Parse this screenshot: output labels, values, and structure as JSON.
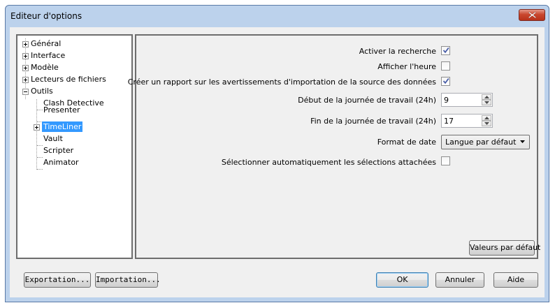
{
  "window": {
    "title": "Editeur d'options",
    "close_icon": "close-x-icon",
    "close_color": "#c9472e"
  },
  "tree": {
    "items": [
      {
        "label": "Général",
        "expander": "plus"
      },
      {
        "label": "Interface",
        "expander": "plus"
      },
      {
        "label": "Modèle",
        "expander": "plus"
      },
      {
        "label": "Lecteurs de fichiers",
        "expander": "plus"
      },
      {
        "label": "Outils",
        "expander": "minus"
      },
      {
        "label": "Clash Detective"
      },
      {
        "label": "Presenter"
      },
      {
        "label": "TimeLiner",
        "expander": "plus",
        "selected": true
      },
      {
        "label": "Vault"
      },
      {
        "label": "Scripter"
      },
      {
        "label": "Animator"
      }
    ],
    "selection_color": "#3399ff"
  },
  "options": {
    "activer_recherche": {
      "label": "Activer la recherche",
      "checked": true
    },
    "afficher_heure": {
      "label": "Afficher l'heure",
      "checked": false
    },
    "creer_rapport": {
      "label": "Créer un rapport sur les avertissements d'importation de la source des données",
      "checked": true
    },
    "debut_journee": {
      "label": "Début de la journée de travail (24h)",
      "value": "9"
    },
    "fin_journee": {
      "label": "Fin de la journée de travail (24h)",
      "value": "17"
    },
    "format_date": {
      "label": "Format de date",
      "value": "Langue par défaut"
    },
    "selection_auto": {
      "label": "Sélectionner automatiquement les sélections attachées",
      "checked": false
    }
  },
  "buttons": {
    "defaults": "Valeurs par défaut",
    "export": "Exportation...",
    "import": "Importation...",
    "ok": "OK",
    "cancel": "Annuler",
    "help": "Aide"
  }
}
